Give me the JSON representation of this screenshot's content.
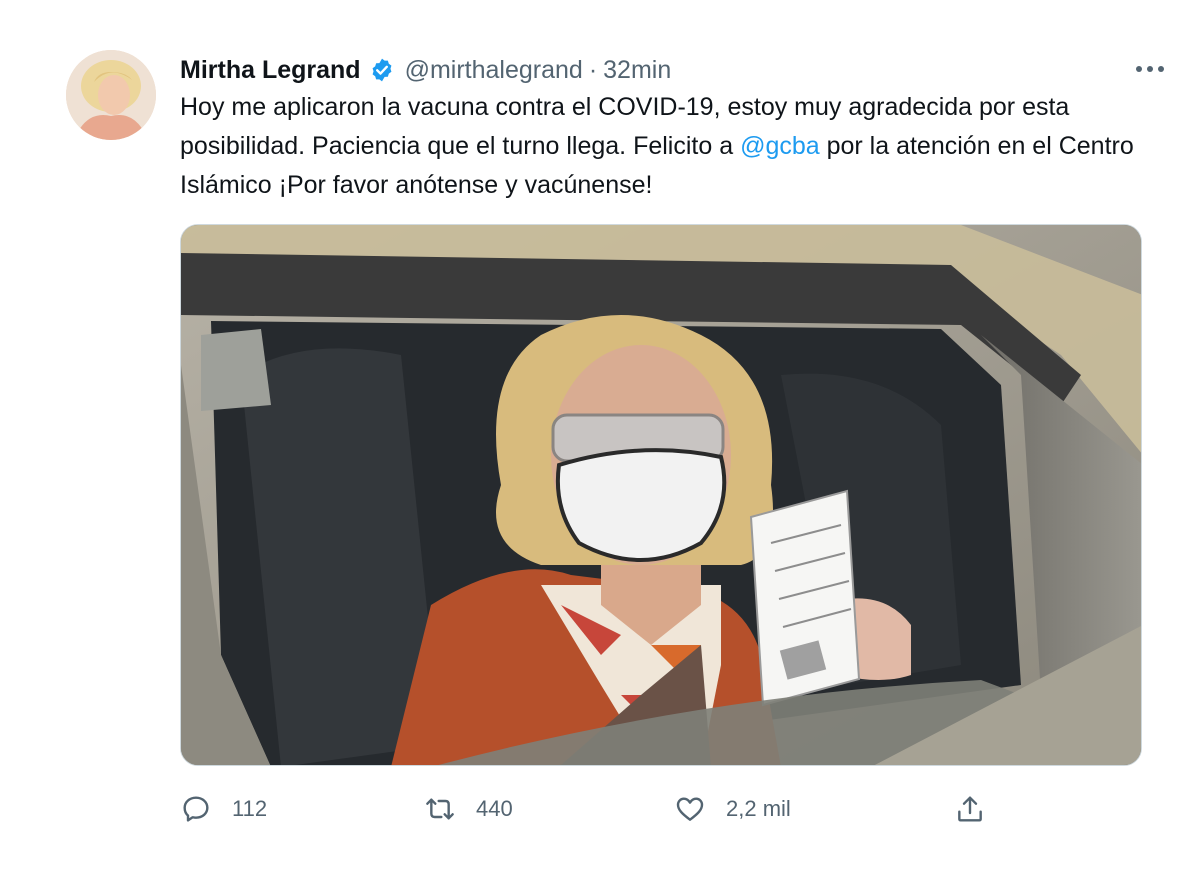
{
  "tweet": {
    "author": {
      "name": "Mirtha Legrand",
      "handle": "@mirthalegrand",
      "verified": true,
      "avatar_icon": "avatar-photo"
    },
    "separator": "·",
    "timestamp": "32min",
    "text_segments": [
      "Hoy me aplicaron la vacuna contra el COVID-19, estoy muy agradecida por esta posibilidad. Paciencia que el turno llega. Felicito a ",
      "@gcba",
      " por la atención en el Centro Islámico ¡Por favor anótense y vacúnense!"
    ],
    "media": {
      "kind": "photo",
      "icon": "photo-woman-in-car-holding-vaccination-card"
    },
    "actions": {
      "reply": {
        "icon": "reply-icon",
        "count": "112"
      },
      "retweet": {
        "icon": "retweet-icon",
        "count": "440"
      },
      "like": {
        "icon": "heart-icon",
        "count": "2,2 mil"
      },
      "share": {
        "icon": "share-icon"
      }
    },
    "more_icon": "more-options-icon"
  },
  "colors": {
    "text": "#0f1419",
    "secondary": "#536471",
    "link": "#1d9bf0",
    "verified": "#1d9bf0"
  }
}
